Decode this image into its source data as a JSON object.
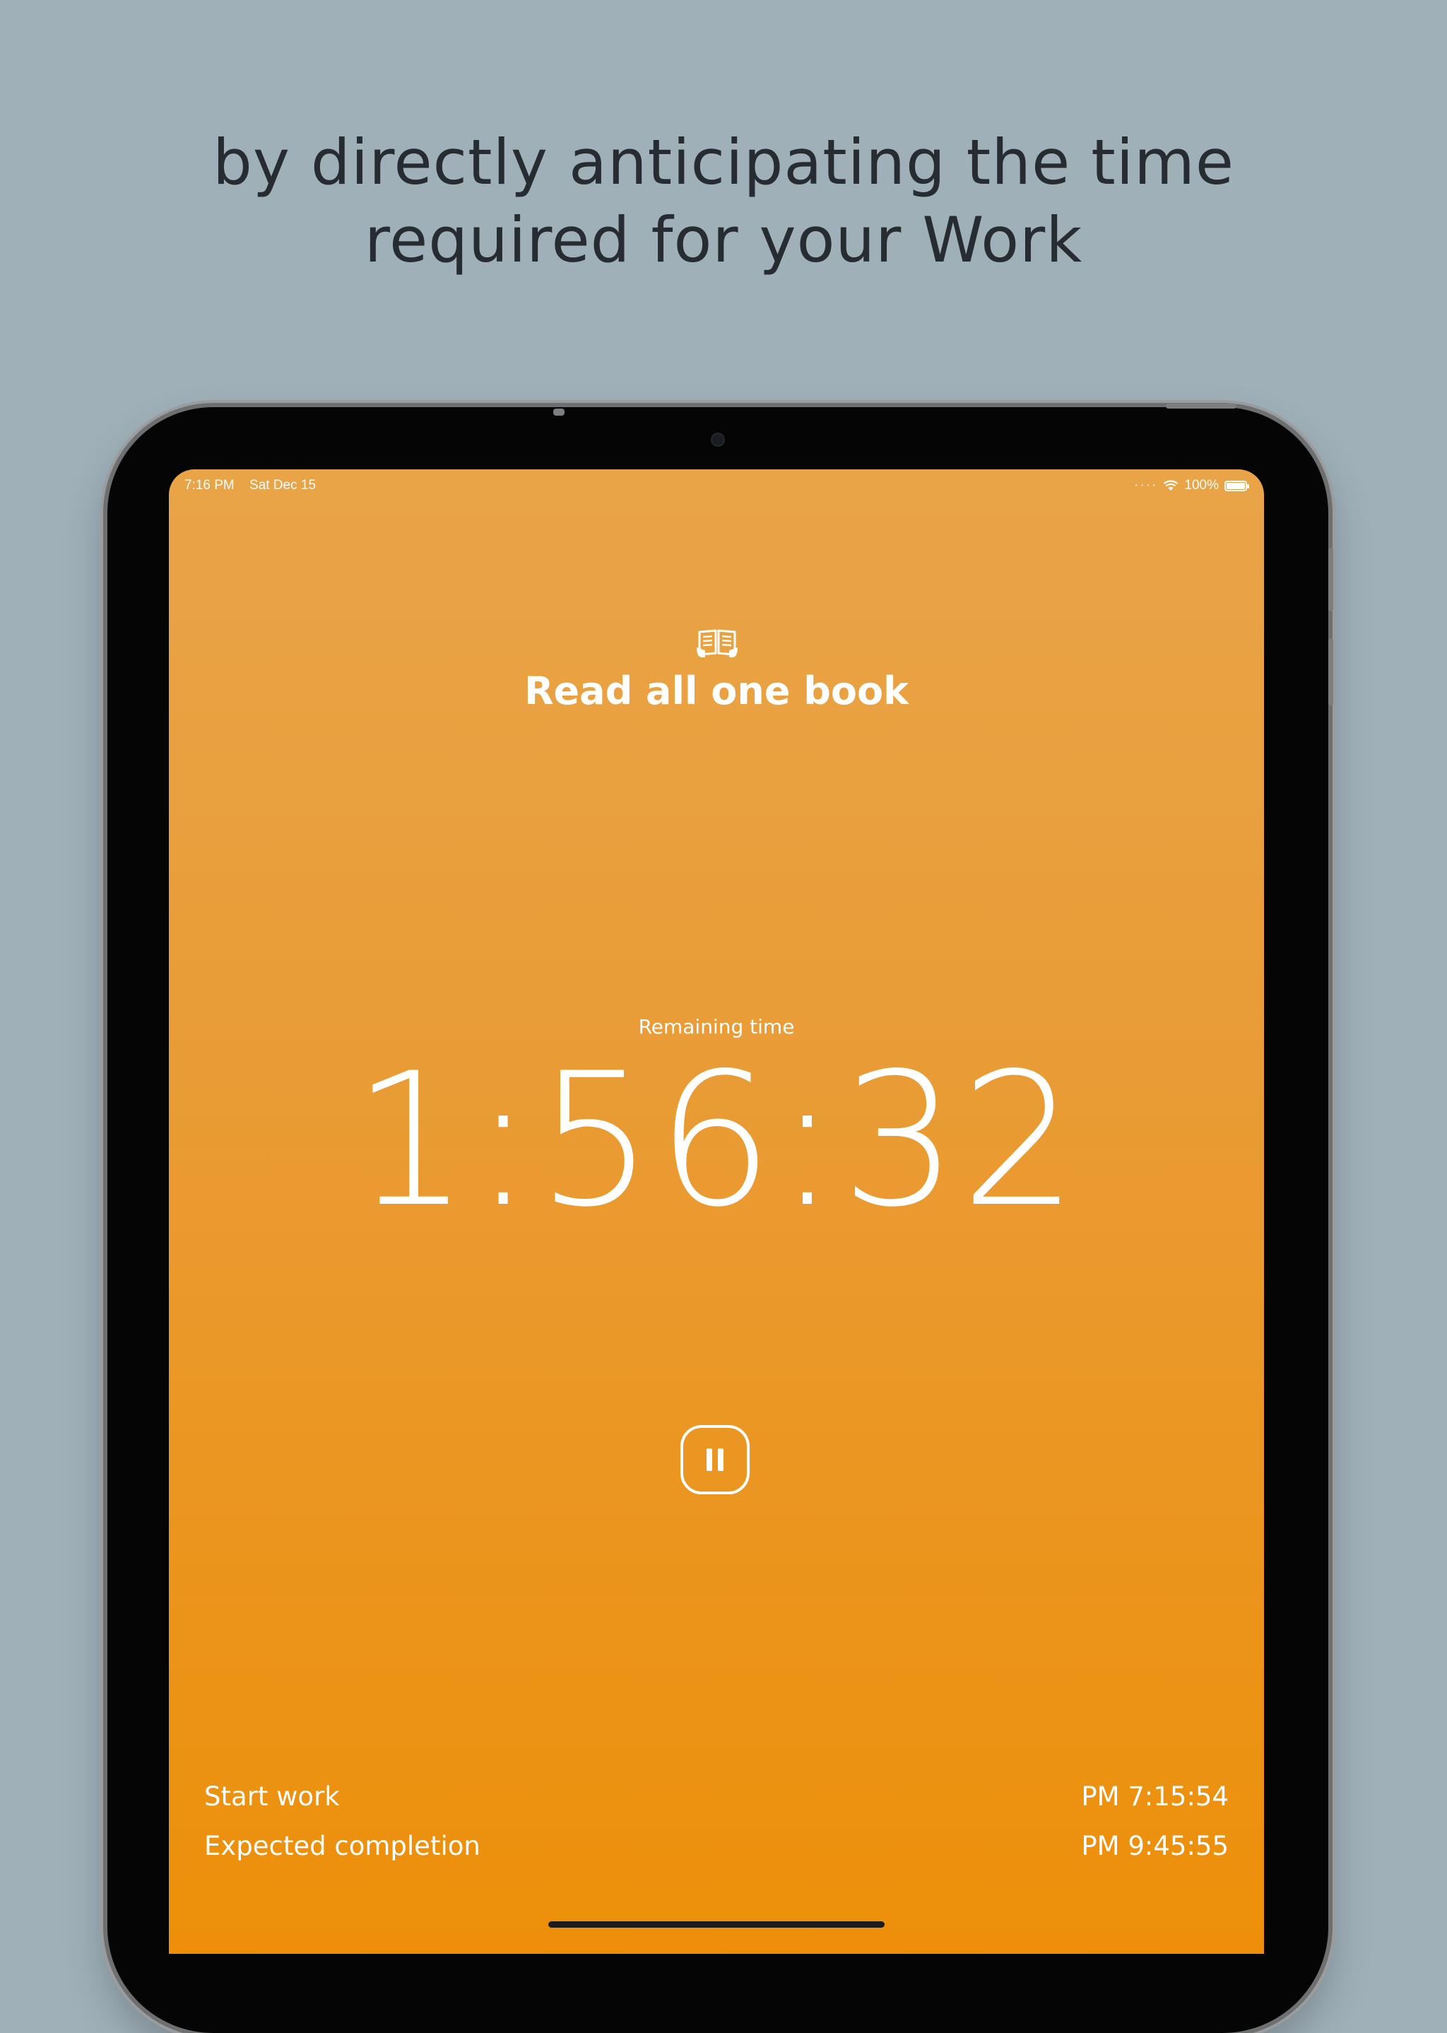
{
  "headline": {
    "line1": "by directly anticipating the time",
    "line2": "required for your Work"
  },
  "status_bar": {
    "time": "7:16 PM",
    "date": "Sat Dec 15",
    "battery": "100%",
    "icons": [
      "signal-dots-icon",
      "wifi-icon",
      "battery-icon"
    ]
  },
  "task": {
    "icon": "open-book-icon",
    "title": "Read all one book"
  },
  "timer": {
    "label": "Remaining time",
    "value": "1:56:32"
  },
  "controls": {
    "pause_icon": "pause-icon"
  },
  "schedule": {
    "start_label": "Start work",
    "start_value": "PM 7:15:54",
    "end_label": "Expected completion",
    "end_value": "PM 9:45:55"
  },
  "colors": {
    "background": "#9fb0b9",
    "headline_text": "#262c31",
    "screen_top": "#e9a448",
    "screen_bottom": "#ed8f09",
    "foreground": "#ffffff"
  }
}
